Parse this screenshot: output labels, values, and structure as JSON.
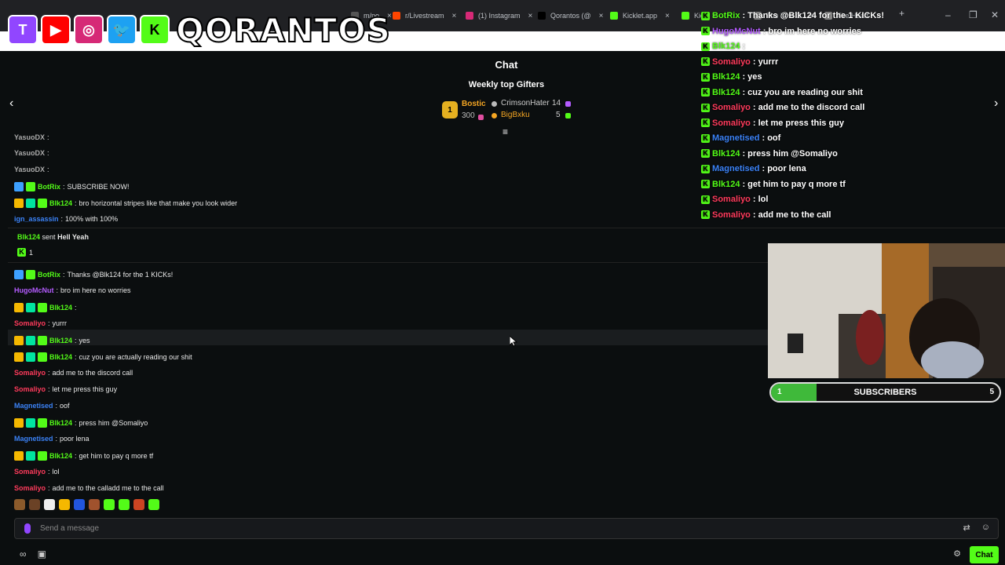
{
  "browser": {
    "tabs": [
      {
        "label": "m/po",
        "color": "#555"
      },
      {
        "label": "r/Livestream",
        "color": "#ff4500"
      },
      {
        "label": "(1) Instagram",
        "color": "#d62976"
      },
      {
        "label": "Qorantos (@",
        "color": "#000000"
      },
      {
        "label": "Kicklet.app",
        "color": "#53fc18"
      },
      {
        "label": "Kic",
        "color": "#53fc18"
      },
      {
        "label": "The best C",
        "color": "#888"
      },
      {
        "label": "Fire Heart",
        "color": "#888"
      }
    ],
    "new_tab": "+",
    "window_controls": [
      "–",
      "❐",
      "✕"
    ]
  },
  "overlay": {
    "brand": "QORANTOS",
    "socials": [
      {
        "name": "twitch-icon",
        "glyph": "T"
      },
      {
        "name": "youtube-icon",
        "glyph": "▶"
      },
      {
        "name": "instagram-icon",
        "glyph": "◎"
      },
      {
        "name": "twitter-icon",
        "glyph": "🐦"
      },
      {
        "name": "kick-icon",
        "glyph": "K"
      }
    ]
  },
  "header": {
    "title": "Chat",
    "gifters_title": "Weekly top Gifters",
    "prev": "‹",
    "next": "›",
    "gifters": [
      {
        "rank": "1",
        "name": "Bostic",
        "count": "300"
      },
      {
        "name": "CrimsonHater",
        "count": "14"
      },
      {
        "name": "BigBxku",
        "count": "5"
      }
    ]
  },
  "chat": {
    "messages": [
      {
        "user": "YasuoDX",
        "text": "",
        "color": "c-gray",
        "badges": []
      },
      {
        "user": "YasuoDX",
        "text": "",
        "color": "c-gray",
        "badges": []
      },
      {
        "user": "YasuoDX",
        "text": "",
        "color": "c-gray",
        "badges": []
      },
      {
        "user": "BotRix",
        "text": "SUBSCRIBE NOW!",
        "color": "c-green",
        "badges": [
          "mod",
          "gift"
        ]
      },
      {
        "user": "Blk124",
        "text": "bro horizontal stripes like that make you look wider",
        "color": "c-green",
        "badges": [
          "crown",
          "sub",
          "gift"
        ]
      },
      {
        "user": "ign_assassin",
        "text": "100% with 100%",
        "color": "c-blue",
        "badges": []
      },
      {
        "user": "BotRix",
        "text": "Thanks @Blk124 for the 1 KICKs!",
        "color": "c-green",
        "badges": [
          "mod",
          "gift"
        ]
      },
      {
        "user": "HugoMcNut",
        "text": "bro im here no worries",
        "color": "c-purple",
        "badges": []
      },
      {
        "user": "Blk124",
        "text": "",
        "color": "c-green",
        "badges": [
          "crown",
          "sub",
          "gift"
        ]
      },
      {
        "user": "Somaliyo",
        "text": "yurrr",
        "color": "c-red",
        "badges": []
      },
      {
        "user": "Blk124",
        "text": "yes",
        "color": "c-green",
        "badges": [
          "crown",
          "sub",
          "gift"
        ]
      },
      {
        "user": "Blk124",
        "text": "cuz you are actually reading our shit",
        "color": "c-green",
        "badges": [
          "crown",
          "sub",
          "gift"
        ]
      },
      {
        "user": "Somaliyo",
        "text": "add me to the discord call",
        "color": "c-red",
        "badges": []
      },
      {
        "user": "Somaliyo",
        "text": "let me press this guy",
        "color": "c-red",
        "badges": []
      },
      {
        "user": "Magnetised",
        "text": "oof",
        "color": "c-blue",
        "badges": []
      },
      {
        "user": "Blk124",
        "text": "press him @Somaliyo",
        "color": "c-green",
        "badges": [
          "crown",
          "sub",
          "gift"
        ]
      },
      {
        "user": "Magnetised",
        "text": "poor lena",
        "color": "c-blue",
        "badges": []
      },
      {
        "user": "Blk124",
        "text": "get him to pay q more tf",
        "color": "c-green",
        "badges": [
          "crown",
          "sub",
          "gift"
        ]
      },
      {
        "user": "Somaliyo",
        "text": "lol",
        "color": "c-red",
        "badges": []
      },
      {
        "user": "Somaliyo",
        "text": "add me to the calladd me to the call",
        "color": "c-red",
        "badges": []
      }
    ],
    "kick_event": {
      "user": "Blk124",
      "sent": "sent",
      "item": "Hell Yeah",
      "count": "1"
    }
  },
  "input": {
    "placeholder": "Send a message",
    "send_label": "Chat"
  },
  "emotes": [
    "#8b5a2b",
    "#6b4226",
    "#eeeeee",
    "#f5b800",
    "#2255dd",
    "#a0522d",
    "#53fc18",
    "#53fc18",
    "#cc4422",
    "#53fc18"
  ],
  "overlay_chat": {
    "messages": [
      {
        "user": "BotRix",
        "text": "Thanks @Blk124 for the 1 KICKs!",
        "color": "c-green"
      },
      {
        "user": "HugoMcNut",
        "text": "bro im here no worries",
        "color": "c-purple"
      },
      {
        "user": "Blk124",
        "text": "",
        "color": "c-green"
      },
      {
        "user": "Somaliyo",
        "text": "yurrr",
        "color": "c-red"
      },
      {
        "user": "Blk124",
        "text": "yes",
        "color": "c-green"
      },
      {
        "user": "Blk124",
        "text": "cuz you are reading our shit",
        "color": "c-green"
      },
      {
        "user": "Somaliyo",
        "text": "add me to the discord call",
        "color": "c-red"
      },
      {
        "user": "Somaliyo",
        "text": "let me press this guy",
        "color": "c-red"
      },
      {
        "user": "Magnetised",
        "text": "oof",
        "color": "c-blue"
      },
      {
        "user": "Blk124",
        "text": "press him @Somaliyo",
        "color": "c-green"
      },
      {
        "user": "Magnetised",
        "text": "poor lena",
        "color": "c-blue"
      },
      {
        "user": "Blk124",
        "text": "get him to pay q more tf",
        "color": "c-green"
      },
      {
        "user": "Somaliyo",
        "text": "lol",
        "color": "c-red"
      },
      {
        "user": "Somaliyo",
        "text": "add me to the call",
        "color": "c-red"
      }
    ]
  },
  "sub_goal": {
    "current": "1",
    "label": "SUBSCRIBERS",
    "target": "5",
    "progress": 0.2
  }
}
